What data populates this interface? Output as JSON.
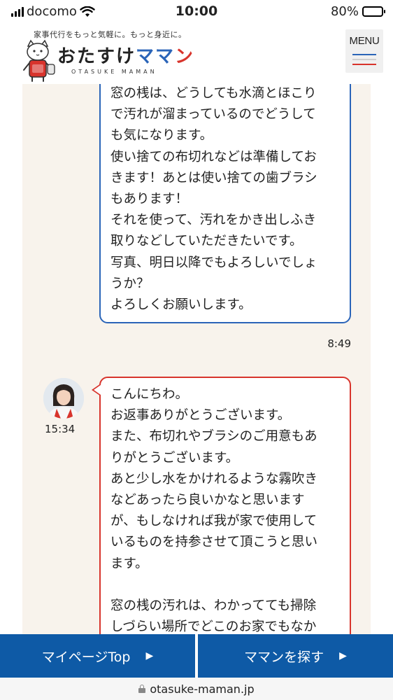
{
  "status_bar": {
    "carrier": "docomo",
    "time": "10:00",
    "battery": "80%",
    "battery_level": 0.8
  },
  "header": {
    "tagline": "家事代行をもっと気軽に。もっと身近に。",
    "logo_prefix": "おたすけ",
    "logo_ma1": "マ",
    "logo_ma2": "マ",
    "logo_n": "ン",
    "logo_sub": "OTASUKE MAMAN",
    "menu_label": "MENU",
    "brand_blue": "#2a64b8",
    "brand_red": "#d8342c"
  },
  "chat": {
    "sent_message": {
      "lines": [
        "窓の桟は、どうしても水滴とほこり",
        "で汚れが溜まっているのでどうして",
        "も気になります。",
        "使い捨ての布切れなどは準備してお",
        "きます！あとは使い捨ての歯ブラシ",
        "もあります！",
        "それを使って、汚れをかき出しふき",
        "取りなどしていただきたいです。",
        "写真、明日以降でもよろしいでしょ",
        "うか？",
        "よろしくお願いします。"
      ],
      "time": "8:49"
    },
    "received_message": {
      "lines": [
        "こんにちわ。",
        "お返事ありがとうございます。",
        "また、布切れやブラシのご用意もあ",
        "りがとうございます。",
        "あと少し水をかけれるような霧吹き",
        "などあったら良いかなと思います",
        "が、もしなければ我が家で使用して",
        "いるものを持参させて頂こうと思い",
        "ます。"
      ],
      "lines_after_break": [
        "窓の桟の汚れは、わかってても掃除",
        "しづらい場所でどこのお家でもなか"
      ],
      "time": "15:34"
    }
  },
  "bottom_nav": {
    "mypage_label": "マイページTop",
    "search_label": "ママンを探す",
    "arrow": "▶"
  },
  "url_bar": {
    "domain": "otasuke-maman.jp"
  }
}
